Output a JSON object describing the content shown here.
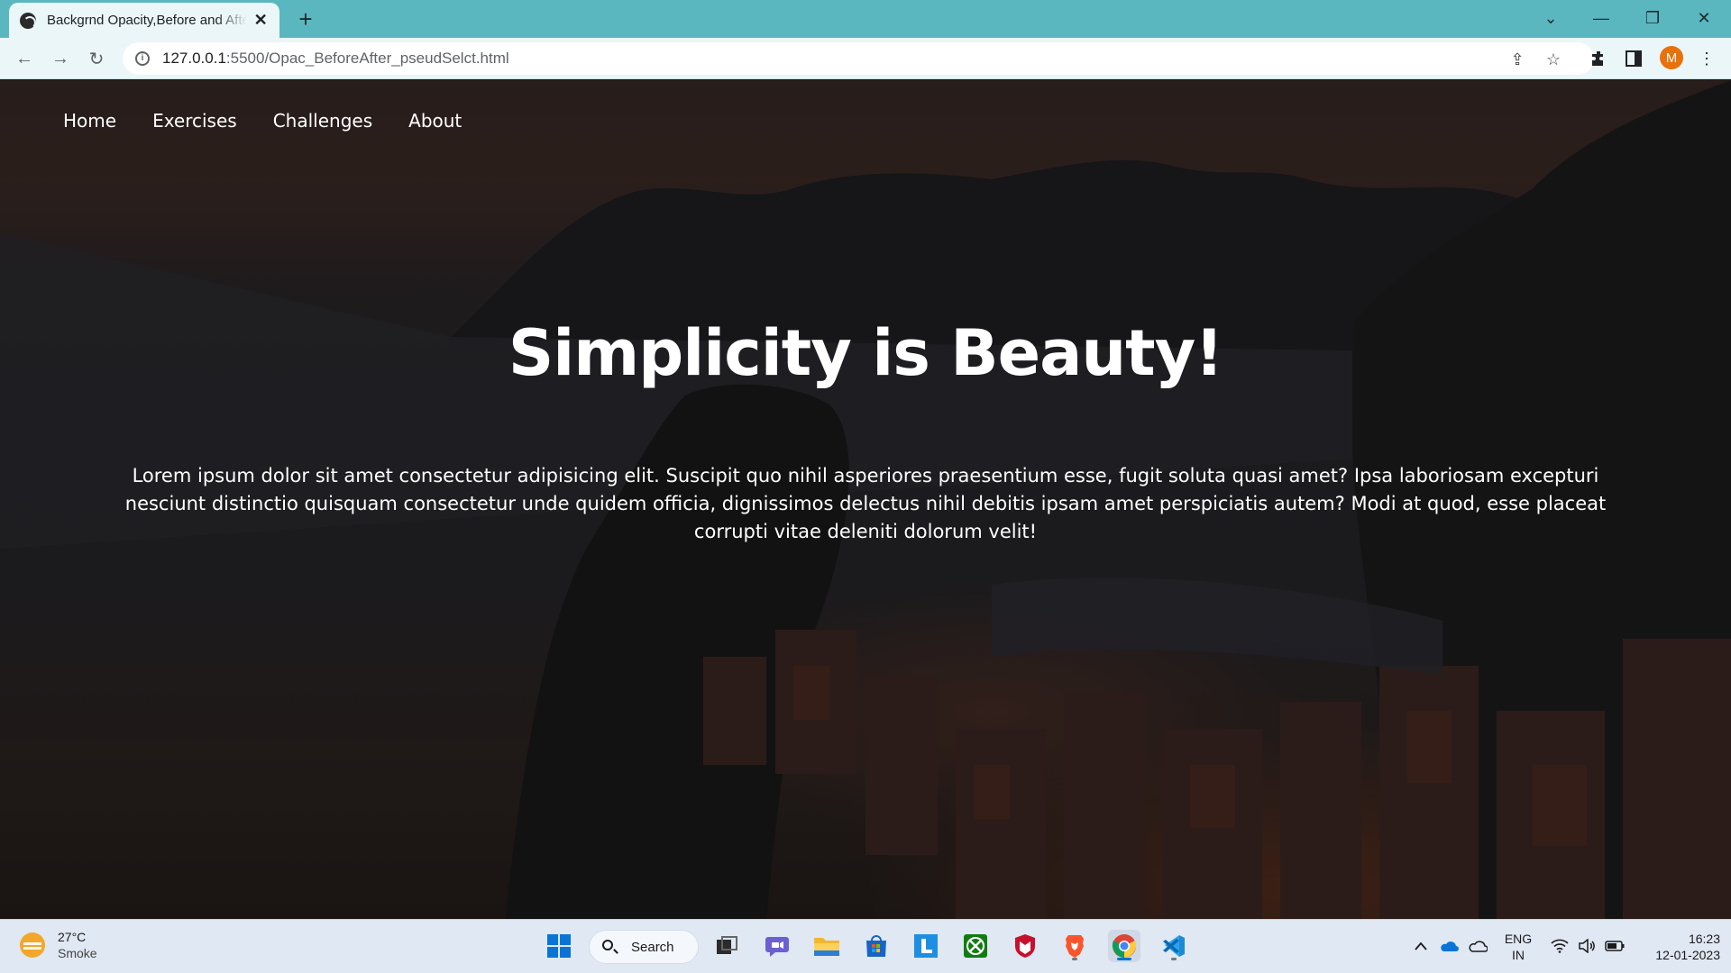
{
  "browser": {
    "tab_title": "Backgrnd Opacity,Before and After",
    "url_host": "127.0.0.1",
    "url_rest": ":5500/Opac_BeforeAfter_pseudSelct.html",
    "profile_initial": "M"
  },
  "site": {
    "nav": [
      "Home",
      "Exercises",
      "Challenges",
      "About"
    ],
    "hero_title": "Simplicity is Beauty!",
    "hero_text": "Lorem ipsum dolor sit amet consectetur adipisicing elit. Suscipit quo nihil asperiores praesentium esse, fugit soluta quasi amet? Ipsa laboriosam excepturi nesciunt distinctio quisquam consectetur unde quidem officia, dignissimos delectus nihil debitis ipsam amet perspiciatis autem? Modi at quod, esse placeat corrupti vitae deleniti dolorum velit!"
  },
  "taskbar": {
    "weather_temp": "27°C",
    "weather_cond": "Smoke",
    "search_label": "Search",
    "lang_line1": "ENG",
    "lang_line2": "IN",
    "time": "16:23",
    "date": "12-01-2023"
  },
  "colors": {
    "tabstrip": "#5ab7c0",
    "toolbar": "#eaf6f8",
    "accent": "#0a74d6",
    "profile": "#e8710a"
  }
}
